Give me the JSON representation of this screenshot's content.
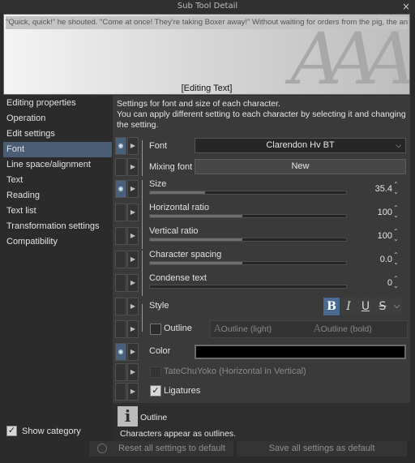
{
  "window": {
    "title": "Sub Tool Detail",
    "close": "×"
  },
  "preview": {
    "sample_text": "\"Quick, quick!\" he shouted. \"Come at once! They're taking Boxer away!\" Without waiting for orders from the pig, the animals broke off work a",
    "big_glyphs": "AAA",
    "caption": "[Editing Text]"
  },
  "sidebar": {
    "items": [
      {
        "label": "Editing properties"
      },
      {
        "label": "Operation"
      },
      {
        "label": "Edit settings"
      },
      {
        "label": "Font"
      },
      {
        "label": "Line space/alignment"
      },
      {
        "label": "Text"
      },
      {
        "label": "Reading"
      },
      {
        "label": "Text list"
      },
      {
        "label": "Transformation settings"
      },
      {
        "label": "Compatibility"
      }
    ],
    "active_index": 3,
    "show_category": {
      "label": "Show category",
      "checked": true,
      "check": "✓"
    }
  },
  "panel": {
    "description": "Settings for font and size of each character.\nYou can apply different setting to each character by selecting it and changing the setting.",
    "font": {
      "label": "Font",
      "value": "Clarendon Hv BT",
      "chevron": "⌵"
    },
    "mixing_font": {
      "label": "Mixing font",
      "button": "New"
    },
    "size": {
      "label": "Size",
      "value": "35.4",
      "level": 0.28
    },
    "horizontal_ratio": {
      "label": "Horizontal ratio",
      "value": "100",
      "level": 0.47
    },
    "vertical_ratio": {
      "label": "Vertical ratio",
      "value": "100",
      "level": 0.47
    },
    "character_spacing": {
      "label": "Character spacing",
      "value": "0.0",
      "level": 0.47
    },
    "condense_text": {
      "label": "Condense text",
      "value": "0",
      "level": 0.0
    },
    "style": {
      "label": "Style",
      "bold": "B",
      "italic": "I",
      "underline": "U",
      "strike": "S",
      "more": "⌵",
      "bold_on": true
    },
    "outline": {
      "label": "Outline",
      "light": "Outline (light)",
      "bold": "Outline (bold)",
      "checked": false
    },
    "color": {
      "label": "Color",
      "value": "#000000"
    },
    "tatechuyoko": {
      "label": "TateChuYoko (Horizontal in Vertical)"
    },
    "ligatures": {
      "label": "Ligatures",
      "checked": true,
      "check": "✓"
    },
    "eye_icon": "◉",
    "arrow_icon": "▶",
    "spin_up": "⌃",
    "spin_down": "⌄"
  },
  "info": {
    "icon": "i",
    "title": "Outline",
    "text": "Characters appear as outlines."
  },
  "footer": {
    "reset": "Reset all settings to default",
    "save": "Save all settings as default"
  },
  "colors": {
    "accent": "#4b5d74",
    "panel": "#3a3a3a",
    "background": "#2b2b2b"
  }
}
